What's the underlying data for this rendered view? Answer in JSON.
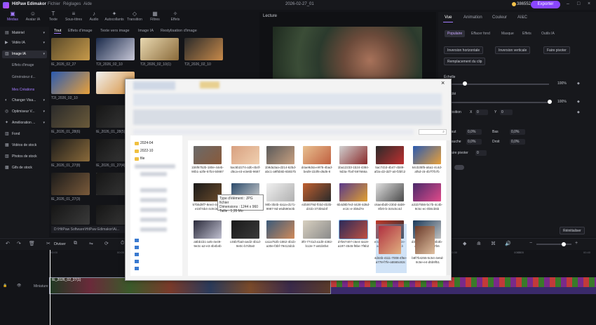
{
  "app": {
    "name": "HitPaw Edimakor",
    "menus": [
      "Fichier",
      "Réglages",
      "Aide"
    ],
    "project_title": "2026-02-27_01",
    "coins": "386552",
    "export_label": "Exporter"
  },
  "tool_tabs": [
    {
      "icon": "▣",
      "label": "Médias"
    },
    {
      "icon": "☺",
      "label": "Avatar IA"
    },
    {
      "icon": "T",
      "label": "Texte"
    },
    {
      "icon": "≡",
      "label": "Sous-titres"
    },
    {
      "icon": "♪",
      "label": "Audio"
    },
    {
      "icon": "✦",
      "label": "Autocollants"
    },
    {
      "icon": "◇",
      "label": "Transition"
    },
    {
      "icon": "▦",
      "label": "Filtres"
    },
    {
      "icon": "✧",
      "label": "Effets"
    }
  ],
  "sidebar": {
    "items": [
      {
        "label": "Matériel"
      },
      {
        "label": "Vidéo IA"
      },
      {
        "label": "Image IA"
      },
      {
        "label": "Changer Visa..."
      },
      {
        "label": "Optimiseur V..."
      },
      {
        "label": "Amélioration ..."
      },
      {
        "label": "Fond"
      },
      {
        "label": "Vidéos de stock"
      },
      {
        "label": "Photos de stock"
      },
      {
        "label": "Gifs de stock"
      }
    ],
    "subitems": [
      "Effets d'image",
      "Générateur d...",
      "Mes Créations"
    ]
  },
  "media": {
    "tabs": [
      "Tout",
      "Effets d'image",
      "Texte vers image",
      "Image IA",
      "Restylisation d'image"
    ],
    "thumbs": [
      {
        "label": "IE_2026_02_27",
        "c1": "#5a4a2a",
        "c2": "#c79a4a"
      },
      {
        "label": "T2I_2026_02_10",
        "c1": "#1a2a4a",
        "c2": "#c8c8d8"
      },
      {
        "label": "T2I_2026_02_10(1)",
        "c1": "#e8d8b0",
        "c2": "#8a6a3a"
      },
      {
        "label": "T2I_2026_02_10",
        "c1": "#2a2a2a",
        "c2": "#c88a4a"
      },
      {
        "label": "T2I_2026_02_10",
        "c1": "#2a5ab0",
        "c2": "#e8a03a"
      },
      {
        "label": "",
        "c1": "#f0f0f0",
        "c2": "#d8903a"
      },
      {
        "label": "IE_2026_01_28(6)",
        "c1": "#2a2a2a",
        "c2": "#6a5a3a"
      },
      {
        "label": "IE_2026_01_28(5)",
        "c1": "#1a1a1a",
        "c2": "#5a4a3a"
      },
      {
        "label": "IE_2026_01_27(8)",
        "c1": "#1a1a1a",
        "c2": "#8a6a3a"
      },
      {
        "label": "IE_2026_01_27(4)",
        "c1": "#1a1a1a",
        "c2": "#4a3a2a"
      },
      {
        "label": "IE_2026_01_27(3)",
        "c1": "#1a1a1a",
        "c2": "#7a5a3a"
      },
      {
        "label": "",
        "c1": "#e0e0e0",
        "c2": "#707070"
      }
    ],
    "path": "D:\\HitPaw Software\\HitPaw Edimakor\\Ai..."
  },
  "preview": {
    "title": "Lecture"
  },
  "right_panel": {
    "tabs": [
      "Vue",
      "Animation",
      "Couleur",
      "AI&C"
    ],
    "subtabs": [
      "Populaire",
      "Effacer fond",
      "Masque",
      "Effets",
      "Outils IA"
    ],
    "buttons": [
      "Inversion horizontale",
      "Inversion verticale",
      "Faire pivoter",
      "Remplacement du clip"
    ],
    "scale_label": "Échelle",
    "scale_value": "100%",
    "opacity_label": "Opacité",
    "opacity_value": "100%",
    "position_label": "Position",
    "pos_x": "0",
    "pos_y": "0",
    "crop_top_label": "Haut",
    "crop_bottom_label": "Bas",
    "crop_left_label": "Gauche",
    "crop_right_label": "Droit",
    "crop_value": "0,0%",
    "rotate_label": "Faire pivoter",
    "rotate_value": "0",
    "reset_label": "Réinitialiser"
  },
  "toolbar": {
    "split_label": "Diviser",
    "time_mark": "00:05"
  },
  "timeline": {
    "ruler": [
      "00:00",
      "00:05",
      "00:10",
      "00:15",
      "00:20",
      "00:25",
      "00:30",
      "00:35",
      "00:40"
    ],
    "clip_label": "IE_2026_02_27(1)",
    "track_label": "Miniature"
  },
  "dialog": {
    "nav_items": [
      "2024-04",
      "2022-10",
      "file",
      "Ce PC",
      "Bureau",
      "Documents",
      "Images",
      "Musique",
      "Vidéos",
      "Disque local"
    ],
    "tooltip_lines": [
      "Type d'élément : JPG fichier",
      "Dimensions : 1244 x 960",
      "Taille : 1,35 Mo"
    ],
    "files": [
      {
        "label": "1b5f6752b-180e-44eb-90b1-a3fe-57b4-50887",
        "c1": "#6a6a6a",
        "c2": "#8a5a3a"
      },
      {
        "label": "5ac5b2274-a3b-4b4f-d5ca-e3-e3e6b-9687",
        "c1": "#d8a080",
        "c2": "#f0d0b0"
      },
      {
        "label": "1b9da3aa-d214-62bd-abc1-a9f5b5b-6b5b7b",
        "c1": "#5a5a5a",
        "c2": "#c8a080"
      },
      {
        "label": "d4ae9d4a-e975-4bad-bed9-1b3f6-d6d6-8",
        "c1": "#e8c090",
        "c2": "#c06040"
      },
      {
        "label": "1ba12233-1b24-4384-9d3a-7b4f-597666a",
        "c1": "#d0d0d0",
        "c2": "#8a2a2a"
      },
      {
        "label": "5ac7cb3-4b47-4b89-af2a-d2-dd7-a0-f2bfc2",
        "c1": "#2a2a2a",
        "c2": "#c03030"
      },
      {
        "label": "64cb35f5-a5a1-4c4d-af5d-c5-4b7f7b7b",
        "c1": "#2a5ab0",
        "c2": "#e8a03a"
      },
      {
        "label": "57b5d9f7-8ee4-4c4d-e15f-5b4-4c9c3c5",
        "c1": "#1a1a1a",
        "c2": "#6a4a2a"
      },
      {
        "label": "e2e8cb5f-7e4a-4b5b-a5b1-d42e4f2b",
        "c1": "#2a4a6a",
        "c2": "#d0d0d0"
      },
      {
        "label": "90b-3b4b-4a1a-d171-9987-9d-e6d590e3b",
        "c1": "#f0f0f0",
        "c2": "#b0b0b0"
      },
      {
        "label": "e2b0079d-f03d-4b3b-d31b-373b5d4f",
        "c1": "#c06030",
        "c2": "#2a2a2a"
      },
      {
        "label": "6b4d8b7ed-4428-4d6d-ec2c-e-3b5d7e",
        "c1": "#5a3a8a",
        "c2": "#e0a030"
      },
      {
        "label": "c6ae4bd0-230d-4ab9-8f20-b-3c6c5c4d",
        "c1": "#e0e0e0",
        "c2": "#4a4a4a"
      },
      {
        "label": "a31b7556-bc7b-4c4b-9c5c-ec-0b5cb5b",
        "c1": "#4a2a6a",
        "c2": "#e04a8a"
      },
      {
        "label": "a5bb1b1-a45-4e49-9e3c-a2-e3-4b4b4b",
        "c1": "#2a2a3a",
        "c2": "#c0c0d0"
      },
      {
        "label": "c46b7ba0-aed2-4b1d-9e0c-b7d0a0",
        "c1": "#1a1a1a",
        "c2": "#3a3a3a"
      },
      {
        "label": "ca1a752b-1862-4b1b-a30e-f3bf-79413d1b",
        "c1": "#3a5a7a",
        "c2": "#d08a5a"
      },
      {
        "label": "3f0-7741d-a1d0-4382-b12e-7-a81b0b4",
        "c1": "#d8d0c0",
        "c2": "#8a8a8a"
      },
      {
        "label": "d7b67407-c5e4-4a19-a197-4545-f8be-7f6b2",
        "c1": "#2a2a5a",
        "c2": "#c05040"
      },
      {
        "label": "e3d9d38d-b5ce-472e-adb5-b6-7f5b6-b1b",
        "c1": "#c03a2a",
        "c2": "#2a2a2a"
      },
      {
        "label": "d352c0a6-0e43-4b3b-a5e8-4b-e4bb7b6",
        "c1": "#1a3a5a",
        "c2": "#c0c0c0"
      },
      {
        "label": "4d44b-4111-7008-4f6e-a778-f7fe-a5565c82c",
        "c1": "#b03040",
        "c2": "#e0b080"
      },
      {
        "label": "b8f7b4255-5c54-4e6d-8c5e-e4-d5b9f51",
        "c1": "#6a3a2a",
        "c2": "#e0c0a0"
      }
    ]
  }
}
